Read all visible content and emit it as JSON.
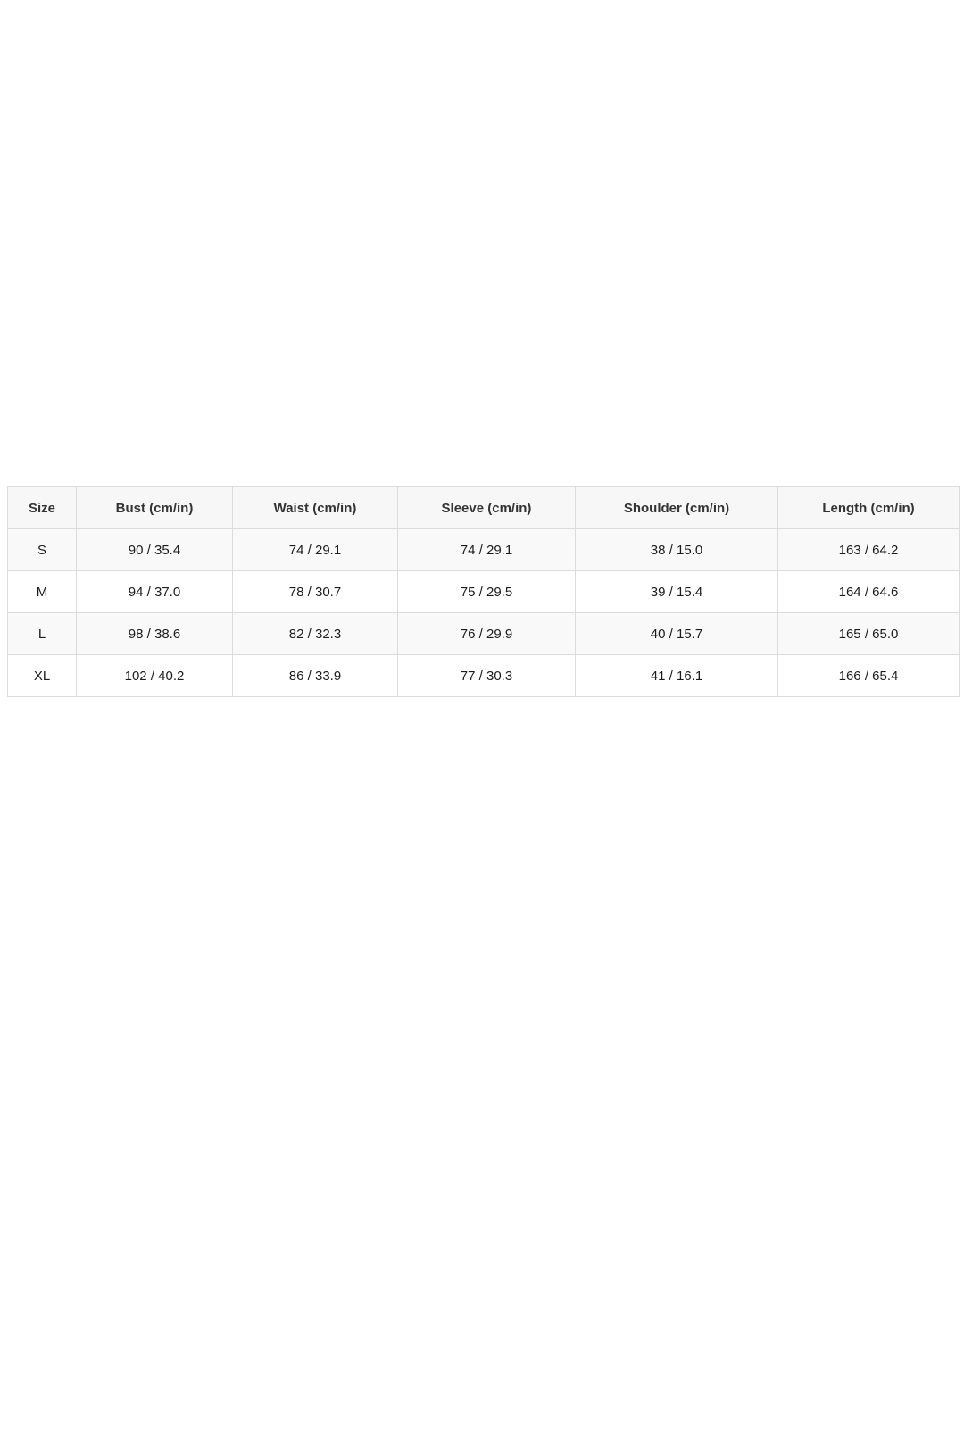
{
  "size_chart": {
    "headers": [
      "Size",
      "Bust (cm/in)",
      "Waist (cm/in)",
      "Sleeve (cm/in)",
      "Shoulder (cm/in)",
      "Length (cm/in)"
    ],
    "rows": [
      [
        "S",
        "90 / 35.4",
        "74 / 29.1",
        "74 / 29.1",
        "38 / 15.0",
        "163 / 64.2"
      ],
      [
        "M",
        "94 / 37.0",
        "78 / 30.7",
        "75 / 29.5",
        "39 / 15.4",
        "164 / 64.6"
      ],
      [
        "L",
        "98 / 38.6",
        "82 / 32.3",
        "76 / 29.9",
        "40 / 15.7",
        "165 / 65.0"
      ],
      [
        "XL",
        "102 / 40.2",
        "86 / 33.9",
        "77 / 30.3",
        "41 / 16.1",
        "166 / 65.4"
      ]
    ]
  },
  "colors": {
    "border": "#dcdcdc",
    "header_background": "#f7f7f7",
    "stripe_background": "#f9f9f9",
    "text": "#1c1c1c"
  }
}
